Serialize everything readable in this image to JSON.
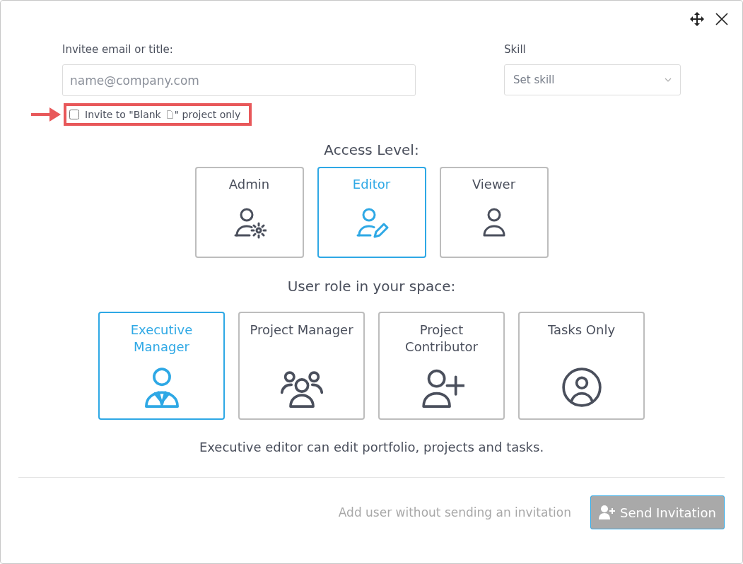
{
  "email": {
    "label": "Invitee email or title:",
    "placeholder": "name@company.com"
  },
  "skill": {
    "label": "Skill",
    "placeholder": "Set skill"
  },
  "project_only": {
    "label_before": "Invite to \"Blank",
    "label_after": "\" project only",
    "checked": false
  },
  "access_level": {
    "title": "Access Level:",
    "options": [
      {
        "label": "Admin",
        "selected": false
      },
      {
        "label": "Editor",
        "selected": true
      },
      {
        "label": "Viewer",
        "selected": false
      }
    ]
  },
  "user_role": {
    "title": "User role in your space:",
    "options": [
      {
        "label": "Executive Manager",
        "selected": true
      },
      {
        "label": "Project Manager",
        "selected": false
      },
      {
        "label": "Project Contributor",
        "selected": false
      },
      {
        "label": "Tasks Only",
        "selected": false
      }
    ]
  },
  "role_description": "Executive editor can edit portfolio, projects and tasks.",
  "footer": {
    "link": "Add user without sending an invitation",
    "button": "Send Invitation"
  }
}
